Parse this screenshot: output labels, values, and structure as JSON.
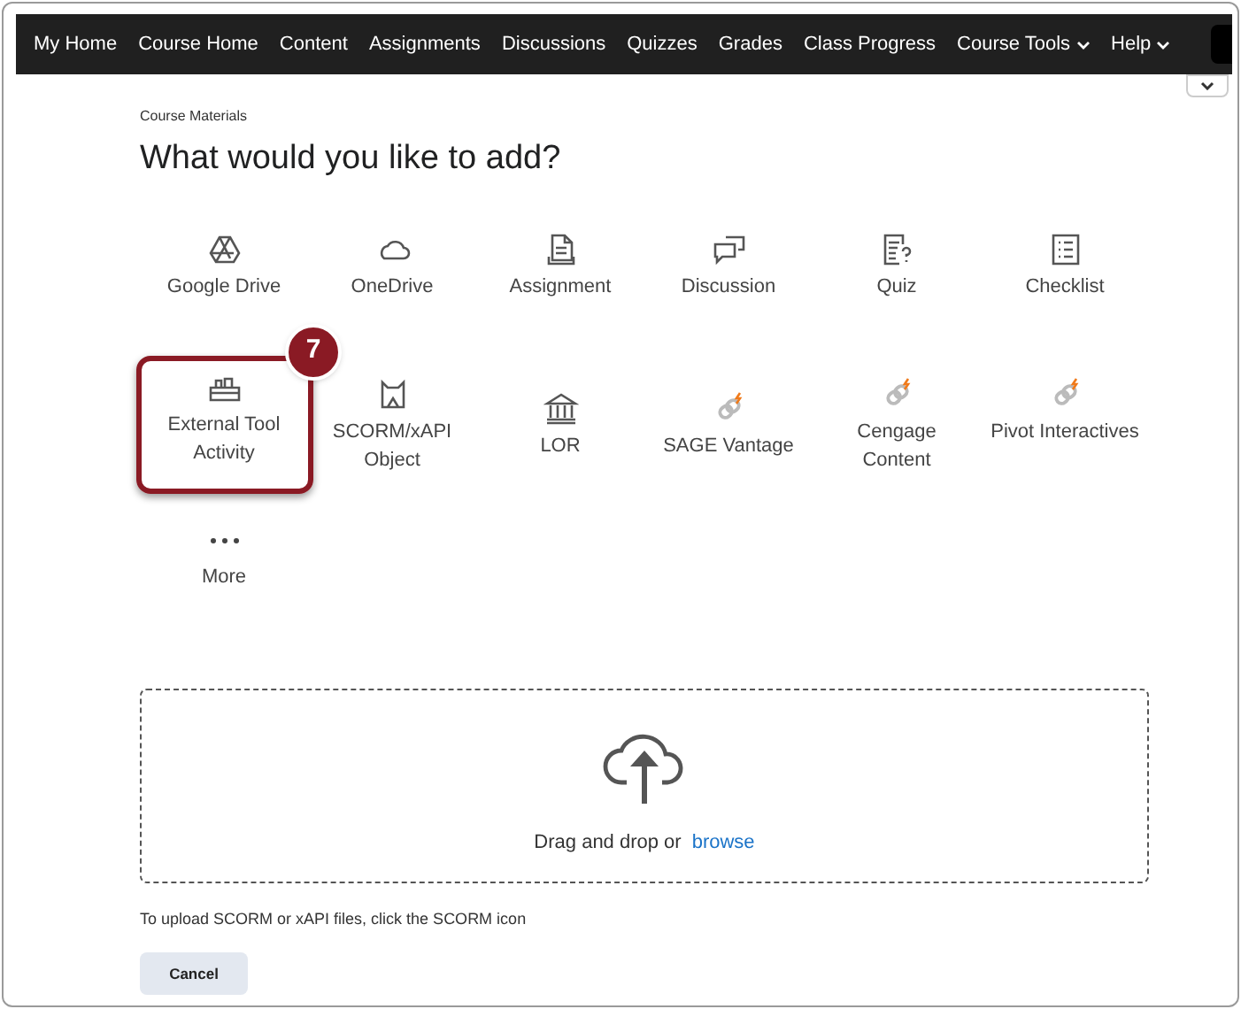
{
  "nav": [
    {
      "label": "My Home",
      "dropdown": false
    },
    {
      "label": "Course Home",
      "dropdown": false
    },
    {
      "label": "Content",
      "dropdown": false
    },
    {
      "label": "Assignments",
      "dropdown": false
    },
    {
      "label": "Discussions",
      "dropdown": false
    },
    {
      "label": "Quizzes",
      "dropdown": false
    },
    {
      "label": "Grades",
      "dropdown": false
    },
    {
      "label": "Class Progress",
      "dropdown": false
    },
    {
      "label": "Course Tools",
      "dropdown": true
    },
    {
      "label": "Help",
      "dropdown": true
    }
  ],
  "breadcrumb": "Course Materials",
  "heading": "What would you like to add?",
  "items": [
    {
      "label": "Google Drive",
      "highlighted": false
    },
    {
      "label": "OneDrive",
      "highlighted": false
    },
    {
      "label": "Assignment",
      "highlighted": false
    },
    {
      "label": "Discussion",
      "highlighted": false
    },
    {
      "label": "Quiz",
      "highlighted": false
    },
    {
      "label": "Checklist",
      "highlighted": false
    },
    {
      "label": "External Tool Activity",
      "highlighted": true
    },
    {
      "label": "SCORM/xAPI Object",
      "highlighted": false
    },
    {
      "label": "LOR",
      "highlighted": false
    },
    {
      "label": "SAGE Vantage",
      "highlighted": false
    },
    {
      "label": "Cengage Content",
      "highlighted": false
    },
    {
      "label": "Pivot Interactives",
      "highlighted": false
    },
    {
      "label": "More",
      "highlighted": false
    }
  ],
  "callout": "7",
  "dropzone": {
    "text": "Drag and drop or",
    "link": "browse"
  },
  "hint": "To upload SCORM or xAPI files, click the SCORM icon",
  "cancel": "Cancel"
}
